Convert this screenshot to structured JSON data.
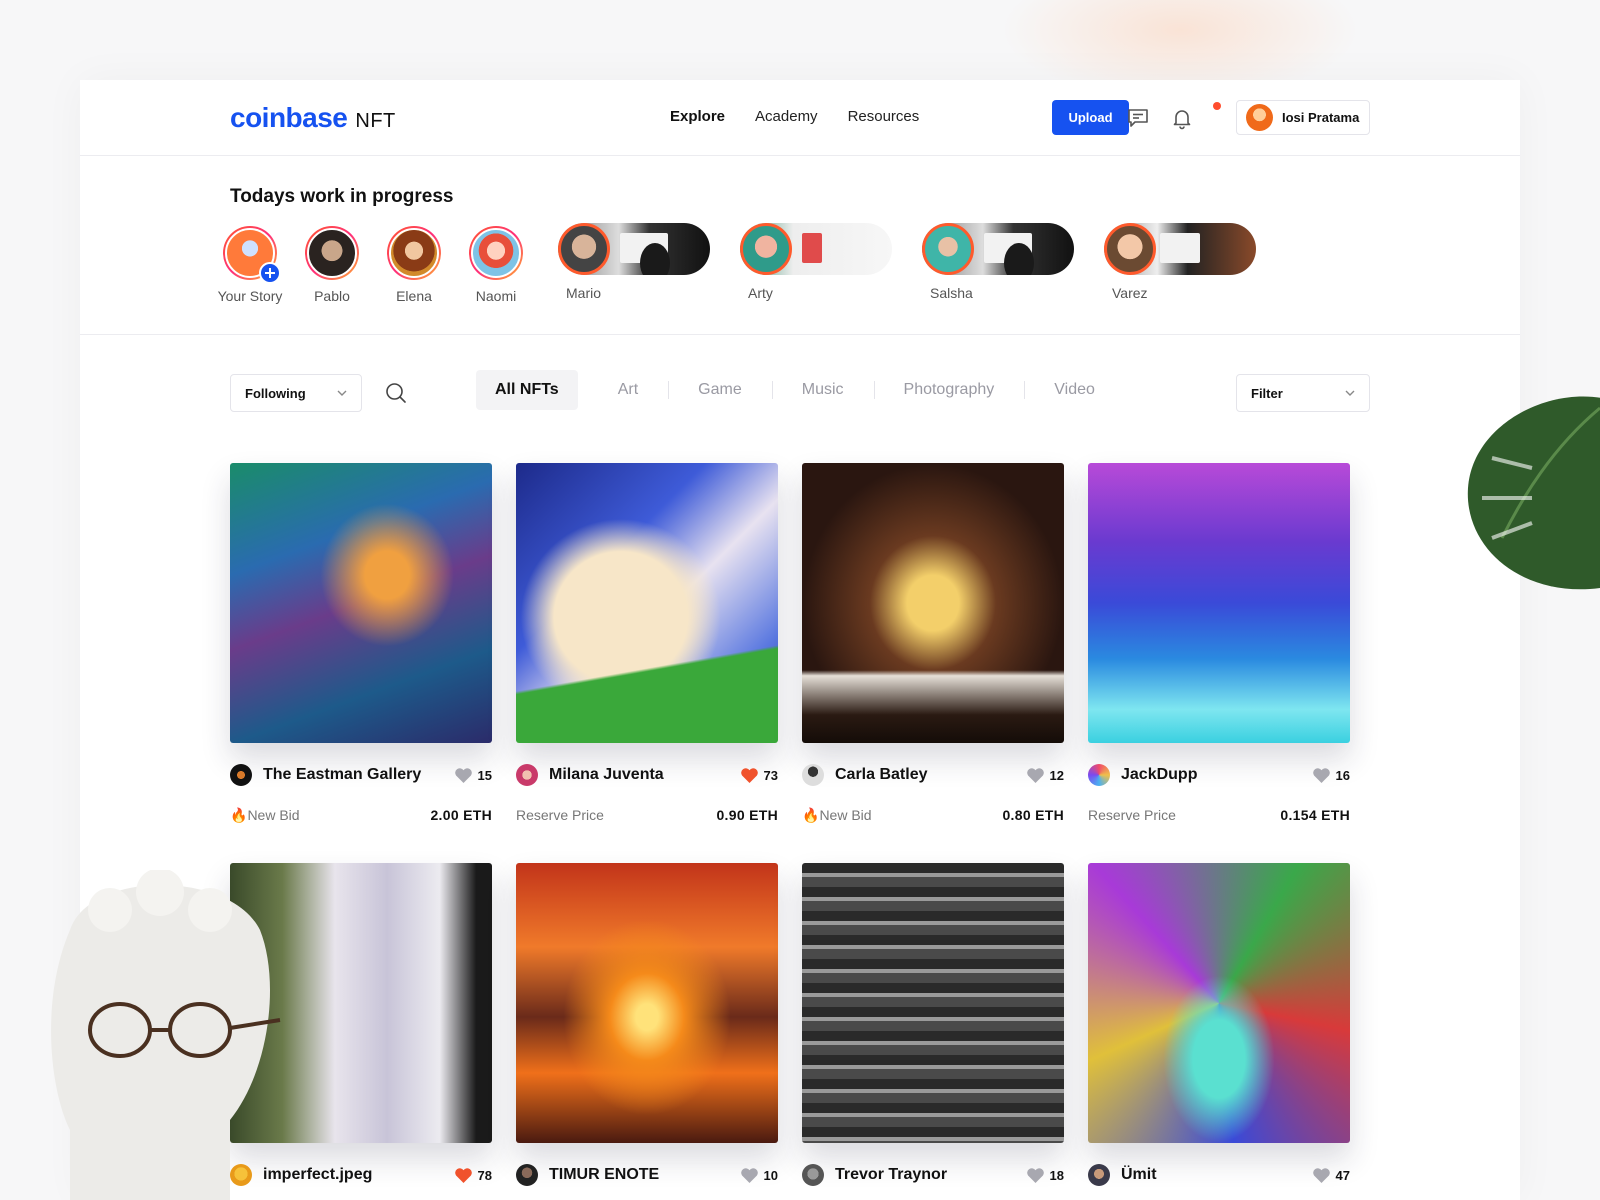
{
  "header": {
    "logo_main": "coinbase",
    "logo_sub": "NFT",
    "nav": [
      {
        "label": "Explore",
        "active": true
      },
      {
        "label": "Academy",
        "active": false
      },
      {
        "label": "Resources",
        "active": false
      }
    ],
    "upload_label": "Upload",
    "icons": [
      "message-icon",
      "bell-icon"
    ],
    "user_name": "Iosi Pratama",
    "brand_color": "#1652f0"
  },
  "stories": {
    "title": "Todays work in progress",
    "items": [
      {
        "name": "Your Story"
      },
      {
        "name": "Pablo"
      },
      {
        "name": "Elena"
      },
      {
        "name": "Naomi"
      },
      {
        "name": "Mario"
      },
      {
        "name": "Arty"
      },
      {
        "name": "Salsha"
      },
      {
        "name": "Varez"
      }
    ]
  },
  "filters": {
    "following_label": "Following",
    "tabs": [
      "All NFTs",
      "Art",
      "Game",
      "Music",
      "Photography",
      "Video"
    ],
    "active_tab": "All NFTs",
    "filter_label": "Filter"
  },
  "cards": [
    {
      "title": "The Eastman Gallery",
      "likes": "15",
      "liked": false,
      "label": "New Bid",
      "hot": true,
      "value": "2.00 ETH"
    },
    {
      "title": "Milana Juventa",
      "likes": "73",
      "liked": true,
      "label": "Reserve Price",
      "hot": false,
      "value": "0.90 ETH"
    },
    {
      "title": "Carla Batley",
      "likes": "12",
      "liked": false,
      "label": "New Bid",
      "hot": true,
      "value": "0.80 ETH"
    },
    {
      "title": "JackDupp",
      "likes": "16",
      "liked": false,
      "label": "Reserve Price",
      "hot": false,
      "value": "0.154 ETH"
    },
    {
      "title": "imperfect.jpeg",
      "likes": "78",
      "liked": true
    },
    {
      "title": "TIMUR ENOTE",
      "likes": "10",
      "liked": false
    },
    {
      "title": "Trevor Traynor",
      "likes": "18",
      "liked": false
    },
    {
      "title": "Ümit",
      "likes": "47",
      "liked": false
    }
  ],
  "colors": {
    "liked": "#f0522c",
    "unliked": "#a8a8b0",
    "hot": "#ff7a1a"
  }
}
